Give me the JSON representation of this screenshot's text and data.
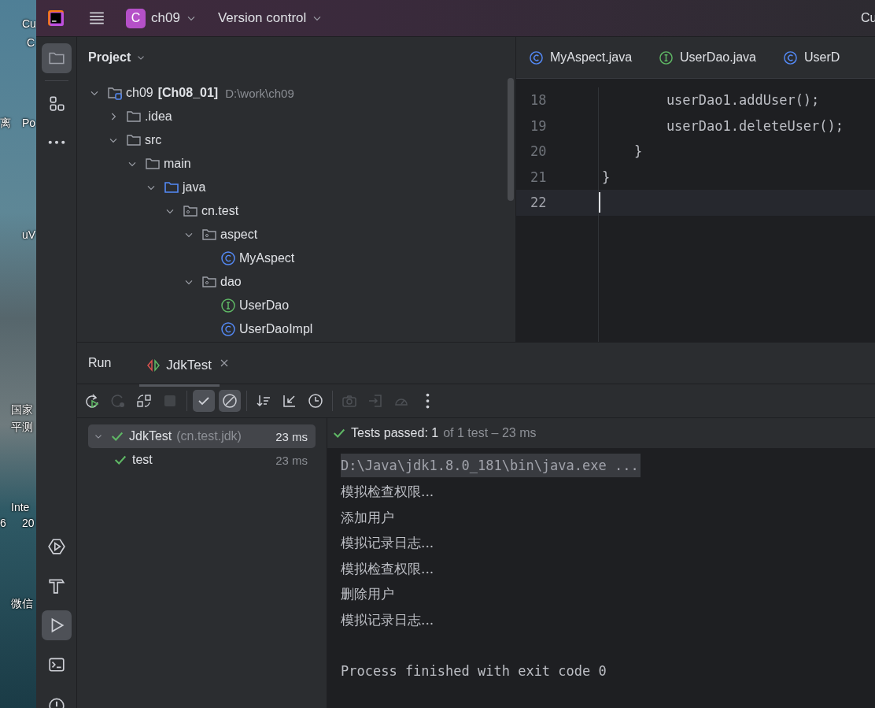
{
  "desktop": {
    "labels": [
      "Cu",
      "C",
      "离",
      "Po",
      "uV",
      "国家",
      "平测",
      "Inte",
      "6",
      "20",
      "微信"
    ]
  },
  "title_bar": {
    "project_badge": "C",
    "project": "ch09",
    "vcs": "Version control",
    "right_text": "Cu"
  },
  "tool_strip": {
    "top": [
      {
        "kind": "folder",
        "selected": true
      },
      {
        "kind": "structure",
        "selected": false
      },
      {
        "kind": "more",
        "selected": false
      }
    ],
    "bottom": [
      {
        "kind": "services",
        "selected": false
      },
      {
        "kind": "build",
        "selected": false
      },
      {
        "kind": "run",
        "selected": true
      },
      {
        "kind": "terminal",
        "selected": false
      },
      {
        "kind": "problems",
        "selected": false
      }
    ]
  },
  "project_panel": {
    "title": "Project",
    "tree": [
      {
        "label": "ch09",
        "qualifier": "[Ch08_01]",
        "path": "D:\\work\\ch09",
        "kind": "module",
        "expanded": true,
        "children": [
          {
            "label": ".idea",
            "kind": "folder",
            "expanded": false
          },
          {
            "label": "src",
            "kind": "folder",
            "expanded": true,
            "children": [
              {
                "label": "main",
                "kind": "folder",
                "expanded": true,
                "children": [
                  {
                    "label": "java",
                    "kind": "source",
                    "expanded": true,
                    "children": [
                      {
                        "label": "cn.test",
                        "kind": "package",
                        "expanded": true,
                        "children": [
                          {
                            "label": "aspect",
                            "kind": "package",
                            "expanded": true,
                            "children": [
                              {
                                "label": "MyAspect",
                                "kind": "class"
                              }
                            ]
                          },
                          {
                            "label": "dao",
                            "kind": "package",
                            "expanded": true,
                            "children": [
                              {
                                "label": "UserDao",
                                "kind": "interface"
                              },
                              {
                                "label": "UserDaoImpl",
                                "kind": "class"
                              }
                            ]
                          }
                        ]
                      }
                    ]
                  }
                ]
              }
            ]
          }
        ]
      }
    ]
  },
  "editor": {
    "tabs": [
      {
        "label": "MyAspect.java",
        "kind": "class"
      },
      {
        "label": "UserDao.java",
        "kind": "interface"
      },
      {
        "label": "UserD",
        "kind": "class"
      }
    ],
    "lines": [
      {
        "number": "18",
        "code": "        userDao1.addUser();",
        "current": false
      },
      {
        "number": "19",
        "code": "        userDao1.deleteUser();",
        "current": false
      },
      {
        "number": "20",
        "code": "    }",
        "current": false
      },
      {
        "number": "21",
        "code": "}",
        "current": false
      },
      {
        "number": "22",
        "current": true
      }
    ]
  },
  "run_panel": {
    "title": "Run",
    "tab": "JdkTest",
    "toolbar": [
      {
        "kind": "rerun",
        "disabled": false,
        "selected": false
      },
      {
        "kind": "rerun-failed",
        "disabled": true,
        "selected": false
      },
      {
        "kind": "toggle",
        "disabled": false,
        "selected": false
      },
      {
        "kind": "stop",
        "disabled": true,
        "selected": false
      },
      {
        "kind": "separator"
      },
      {
        "kind": "check",
        "disabled": false,
        "selected": true
      },
      {
        "kind": "ignored",
        "disabled": false,
        "selected": true
      },
      {
        "kind": "separator"
      },
      {
        "kind": "sort",
        "disabled": false,
        "selected": false
      },
      {
        "kind": "collapse",
        "disabled": false,
        "selected": false
      },
      {
        "kind": "history",
        "disabled": false,
        "selected": false
      },
      {
        "kind": "separator"
      },
      {
        "kind": "camera",
        "disabled": true,
        "selected": false
      },
      {
        "kind": "export",
        "disabled": true,
        "selected": false
      },
      {
        "kind": "gauge",
        "disabled": true,
        "selected": false
      },
      {
        "kind": "more",
        "disabled": false,
        "selected": false
      }
    ],
    "tests": [
      {
        "name": "JdkTest",
        "package": "(cn.test.jdk)",
        "time": "23 ms",
        "passed": true,
        "selected": true,
        "expanded": true,
        "children": [
          {
            "name": "test",
            "time": "23 ms",
            "passed": true,
            "selected": false
          }
        ]
      }
    ],
    "summary": {
      "passed": "Tests passed: 1",
      "detail": "of 1 test – 23 ms"
    },
    "console": [
      {
        "kind": "command",
        "text": "D:\\Java\\jdk1.8.0_181\\bin\\java.exe ..."
      },
      {
        "kind": "output",
        "text": "模拟检查权限..."
      },
      {
        "kind": "output",
        "text": "添加用户"
      },
      {
        "kind": "output",
        "text": "模拟记录日志..."
      },
      {
        "kind": "output",
        "text": "模拟检查权限..."
      },
      {
        "kind": "output",
        "text": "删除用户"
      },
      {
        "kind": "output",
        "text": "模拟记录日志..."
      },
      {
        "kind": "blank"
      },
      {
        "kind": "exit",
        "text": "Process finished with exit code 0"
      }
    ]
  }
}
